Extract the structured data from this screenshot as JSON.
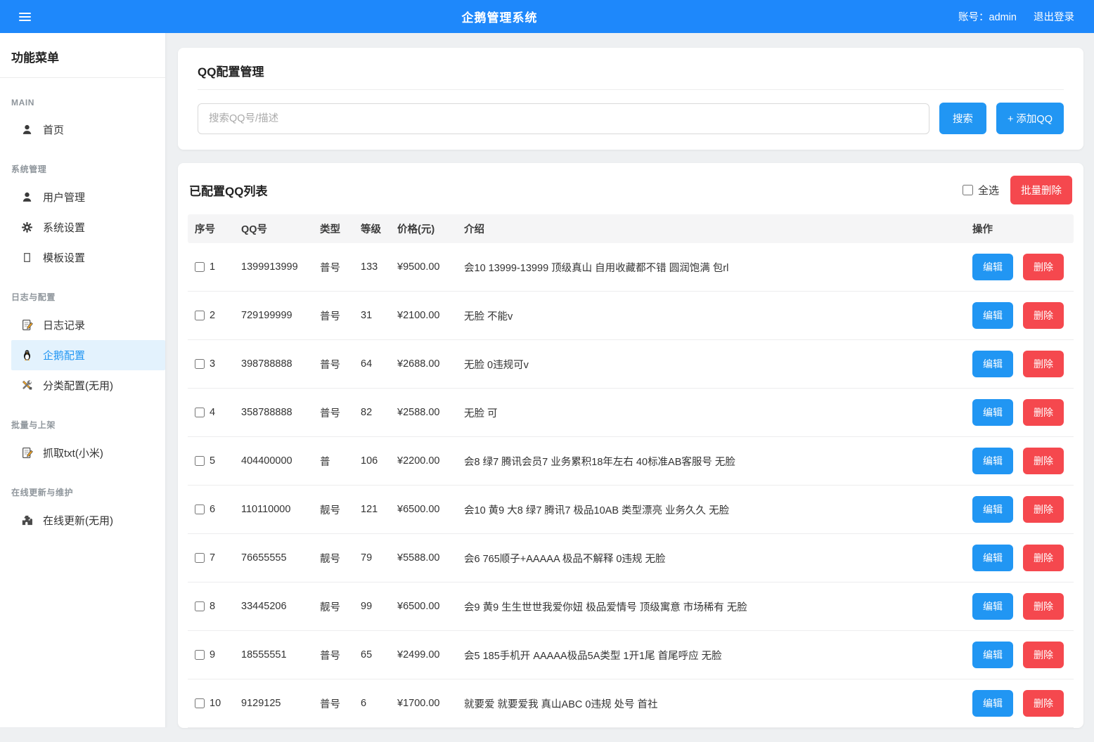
{
  "header": {
    "title": "企鹅管理系统",
    "account": "账号：admin",
    "logout": "退出登录"
  },
  "sidebar": {
    "title": "功能菜单",
    "sections": [
      {
        "label": "MAIN",
        "items": [
          {
            "icon": "user",
            "label": "首页",
            "active": false
          }
        ]
      },
      {
        "label": "系统管理",
        "items": [
          {
            "icon": "user",
            "label": "用户管理",
            "active": false
          },
          {
            "icon": "gear",
            "label": "系统设置",
            "active": false
          },
          {
            "icon": "box",
            "label": "模板设置",
            "active": false
          }
        ]
      },
      {
        "label": "日志与配置",
        "items": [
          {
            "icon": "memo",
            "label": "日志记录",
            "active": false
          },
          {
            "icon": "penguin",
            "label": "企鹅配置",
            "active": true
          },
          {
            "icon": "tools",
            "label": "分类配置(无用)",
            "active": false
          }
        ]
      },
      {
        "label": "批量与上架",
        "items": [
          {
            "icon": "memo",
            "label": "抓取txt(小米)",
            "active": false
          }
        ]
      },
      {
        "label": "在线更新与维护",
        "items": [
          {
            "icon": "puzzle",
            "label": "在线更新(无用)",
            "active": false
          }
        ]
      }
    ]
  },
  "search_card": {
    "title": "QQ配置管理",
    "search_placeholder": "搜索QQ号/描述",
    "search_button": "搜索",
    "add_button": "+ 添加QQ"
  },
  "list_card": {
    "title": "已配置QQ列表",
    "select_all_label": "全选",
    "batch_delete_button": "批量删除",
    "columns": [
      "序号",
      "QQ号",
      "类型",
      "等级",
      "价格(元)",
      "介绍",
      "操作"
    ],
    "edit_button": "编辑",
    "delete_button": "删除",
    "rows": [
      {
        "index": 1,
        "qq": "1399913999",
        "type": "普号",
        "level": "133",
        "price": "¥9500.00",
        "desc": "会10 13999-13999 顶级真山 自用收藏都不错 圆润饱满 包rl"
      },
      {
        "index": 2,
        "qq": "729199999",
        "type": "普号",
        "level": "31",
        "price": "¥2100.00",
        "desc": "无脸 不能v"
      },
      {
        "index": 3,
        "qq": "398788888",
        "type": "普号",
        "level": "64",
        "price": "¥2688.00",
        "desc": "无脸 0违规可v"
      },
      {
        "index": 4,
        "qq": "358788888",
        "type": "普号",
        "level": "82",
        "price": "¥2588.00",
        "desc": "无脸 可"
      },
      {
        "index": 5,
        "qq": "404400000",
        "type": "普",
        "level": "106",
        "price": "¥2200.00",
        "desc": "会8 绿7 腾讯会员7 业务累积18年左右 40标准AB客服号 无脸"
      },
      {
        "index": 6,
        "qq": "110110000",
        "type": "靓号",
        "level": "121",
        "price": "¥6500.00",
        "desc": "会10 黄9 大8 绿7 腾讯7 极品10AB 类型漂亮 业务久久 无脸"
      },
      {
        "index": 7,
        "qq": "76655555",
        "type": "靓号",
        "level": "79",
        "price": "¥5588.00",
        "desc": "会6 765顺子+AAAAA 极品不解释 0违规 无脸"
      },
      {
        "index": 8,
        "qq": "33445206",
        "type": "靓号",
        "level": "99",
        "price": "¥6500.00",
        "desc": "会9 黄9 生生世世我爱你妞 极品爱情号 顶级寓意 市场稀有 无脸"
      },
      {
        "index": 9,
        "qq": "18555551",
        "type": "普号",
        "level": "65",
        "price": "¥2499.00",
        "desc": "会5 185手机开 AAAAA极品5A类型 1开1尾 首尾呼应 无脸"
      },
      {
        "index": 10,
        "qq": "9129125",
        "type": "普号",
        "level": "6",
        "price": "¥1700.00",
        "desc": "就要爱 就要爱我 真山ABC 0违规 处号 首社"
      }
    ]
  },
  "colors": {
    "header_bg": "#1e88fb",
    "primary": "#2196f3",
    "danger": "#f5484e",
    "active_item_bg": "#e3f2fd",
    "page_bg": "#eef0f2"
  }
}
